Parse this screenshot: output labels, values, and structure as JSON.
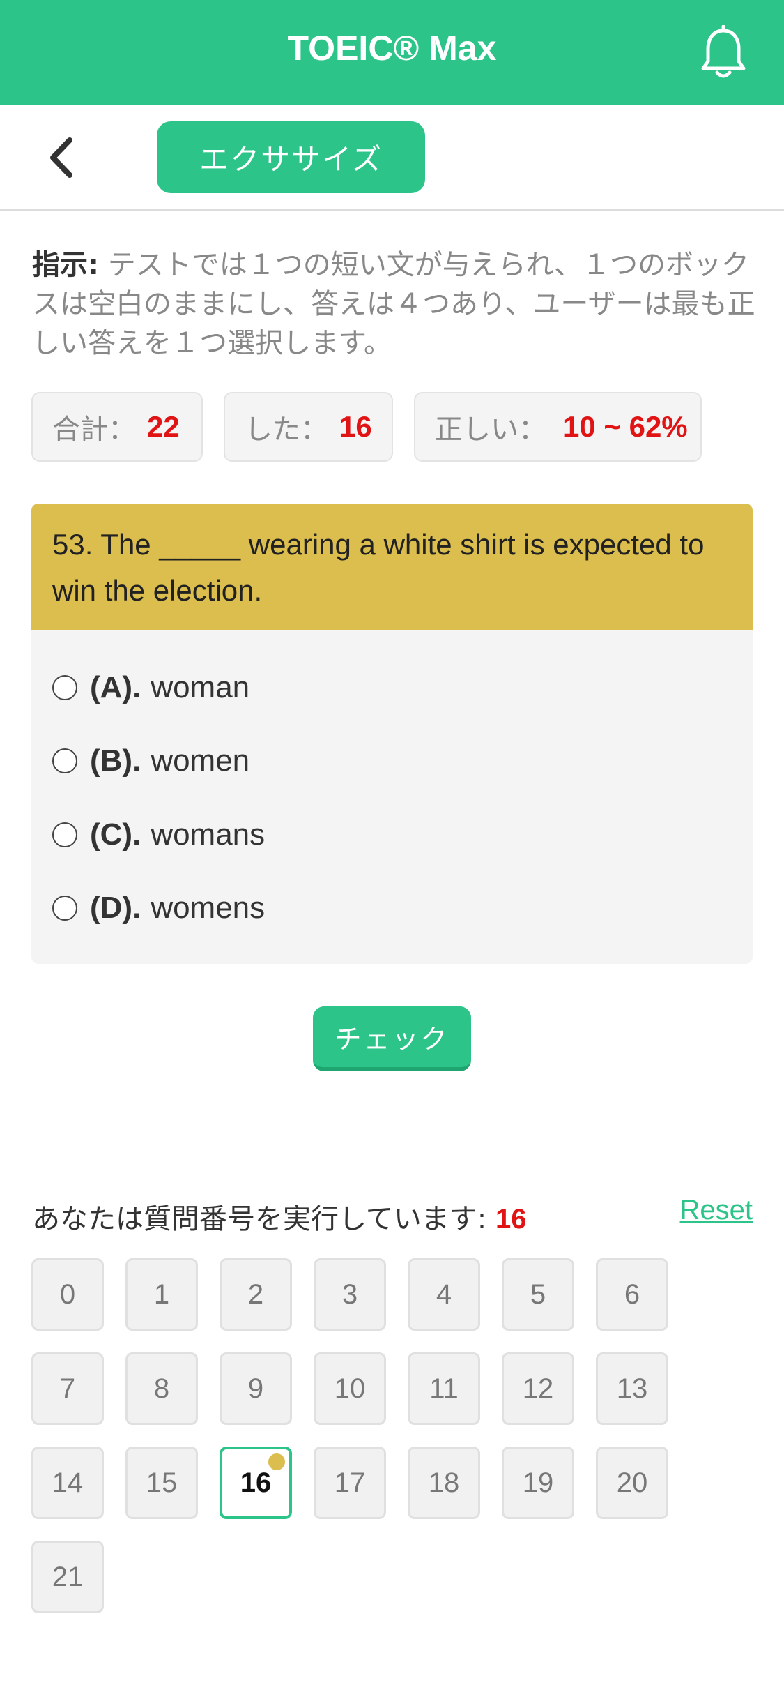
{
  "app": {
    "title": "TOEIC® Max"
  },
  "nav": {
    "tab_label": "エクササイズ"
  },
  "instructions": {
    "label": "指示:",
    "text": " テストでは１つの短い文が与えられ、１つのボックスは空白のままにし、答えは４つあり、ユーザーは最も正しい答えを１つ選択します。"
  },
  "stats": {
    "total_label": "合計：",
    "total_value": "22",
    "done_label": "した：",
    "done_value": "16",
    "correct_label": "正しい：",
    "correct_value": "10 ~ 62%"
  },
  "question": {
    "text": "53. The _____ wearing a white shirt is expected to win the election.",
    "options": [
      {
        "label": "(A).",
        "text": "woman"
      },
      {
        "label": "(B).",
        "text": "women"
      },
      {
        "label": "(C).",
        "text": "womans"
      },
      {
        "label": "(D).",
        "text": "womens"
      }
    ]
  },
  "check_label": "チェック",
  "progress": {
    "running_label": "あなたは質問番号を実行しています:",
    "current": "16",
    "reset_label": "Reset",
    "numbers": [
      "0",
      "1",
      "2",
      "3",
      "4",
      "5",
      "6",
      "7",
      "8",
      "9",
      "10",
      "11",
      "12",
      "13",
      "14",
      "15",
      "16",
      "17",
      "18",
      "19",
      "20",
      "21"
    ]
  },
  "colors": {
    "accent": "#2dc48a",
    "question_bg": "#dbbe4e",
    "highlight": "#e01414"
  }
}
